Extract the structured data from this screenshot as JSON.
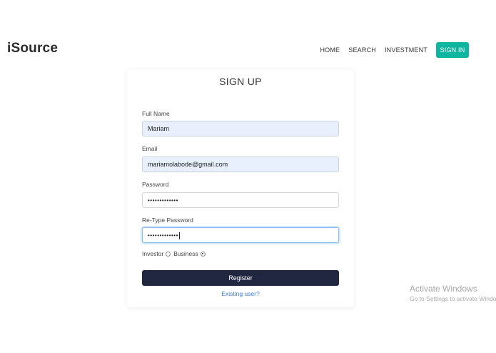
{
  "brand": {
    "logo": "iSource"
  },
  "nav": {
    "home": "HOME",
    "search": "SEARCH",
    "investment": "INVESTMENT",
    "signin": "SIGN IN",
    "signin_color": "#10b5a0"
  },
  "form": {
    "title": "SIGN UP",
    "full_name": {
      "label": "Full Name",
      "value": "Mariam"
    },
    "email": {
      "label": "Email",
      "value": "mariamolabode@gmail.com"
    },
    "password": {
      "label": "Password",
      "value": "•••••••••••••"
    },
    "retype_password": {
      "label": "Re-Type Password",
      "value": "•••••••••••••"
    },
    "account_type": {
      "options": [
        "Investor",
        "Business"
      ],
      "selected": "Business"
    },
    "register_label": "Register",
    "register_color": "#212641",
    "existing_user": "Existing user?"
  },
  "watermark": {
    "title": "Activate Windows",
    "subtitle": "Go to Settings to activate Windows."
  }
}
